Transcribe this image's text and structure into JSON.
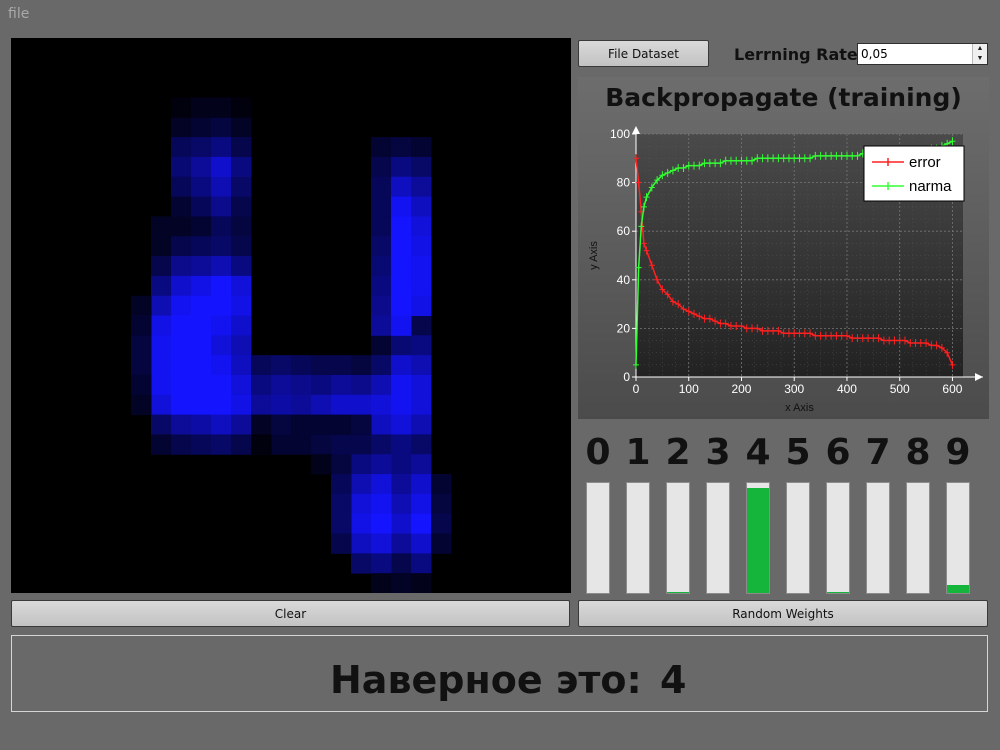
{
  "menu": {
    "file": "file"
  },
  "toolbar": {
    "file_dataset_label": "File Dataset",
    "learning_rate_label": "Lerrning Rate",
    "learning_rate_value": "0,05"
  },
  "canvas": {
    "grid_size": 28,
    "pixels": [
      [
        8,
        4,
        0.15
      ],
      [
        8,
        5,
        0.35
      ],
      [
        8,
        6,
        0.45
      ],
      [
        8,
        7,
        0.35
      ],
      [
        8,
        8,
        0.2
      ],
      [
        8,
        9,
        0.15
      ],
      [
        9,
        4,
        0.2
      ],
      [
        9,
        5,
        0.4
      ],
      [
        9,
        6,
        0.6
      ],
      [
        9,
        7,
        0.5
      ],
      [
        9,
        8,
        0.35
      ],
      [
        9,
        9,
        0.2
      ],
      [
        10,
        4,
        0.25
      ],
      [
        10,
        5,
        0.5
      ],
      [
        10,
        6,
        0.8
      ],
      [
        10,
        7,
        0.7
      ],
      [
        10,
        8,
        0.55
      ],
      [
        10,
        9,
        0.35
      ],
      [
        11,
        4,
        0.15
      ],
      [
        11,
        5,
        0.3
      ],
      [
        11,
        6,
        0.5
      ],
      [
        11,
        7,
        0.4
      ],
      [
        11,
        8,
        0.3
      ],
      [
        11,
        9,
        0.25
      ],
      [
        7,
        10,
        0.15
      ],
      [
        7,
        11,
        0.3
      ],
      [
        7,
        12,
        0.5
      ],
      [
        7,
        13,
        0.7
      ],
      [
        7,
        14,
        0.9
      ],
      [
        7,
        15,
        0.95
      ],
      [
        7,
        16,
        0.95
      ],
      [
        7,
        17,
        0.95
      ],
      [
        7,
        18,
        0.85
      ],
      [
        7,
        19,
        0.4
      ],
      [
        7,
        20,
        0.2
      ],
      [
        8,
        10,
        0.3
      ],
      [
        8,
        11,
        0.55
      ],
      [
        8,
        12,
        0.8
      ],
      [
        8,
        13,
        0.95
      ],
      [
        8,
        14,
        1
      ],
      [
        8,
        15,
        1
      ],
      [
        8,
        16,
        1
      ],
      [
        8,
        17,
        1
      ],
      [
        8,
        18,
        1
      ],
      [
        8,
        19,
        0.6
      ],
      [
        8,
        20,
        0.3
      ],
      [
        9,
        10,
        0.35
      ],
      [
        9,
        11,
        0.6
      ],
      [
        9,
        12,
        0.9
      ],
      [
        9,
        13,
        1
      ],
      [
        9,
        14,
        1
      ],
      [
        9,
        15,
        1
      ],
      [
        9,
        16,
        1
      ],
      [
        9,
        17,
        1
      ],
      [
        9,
        18,
        1
      ],
      [
        9,
        19,
        0.65
      ],
      [
        9,
        20,
        0.35
      ],
      [
        10,
        10,
        0.4
      ],
      [
        10,
        11,
        0.7
      ],
      [
        10,
        12,
        1
      ],
      [
        10,
        13,
        1
      ],
      [
        10,
        14,
        0.95
      ],
      [
        10,
        15,
        0.85
      ],
      [
        10,
        16,
        0.95
      ],
      [
        10,
        17,
        1
      ],
      [
        10,
        18,
        1
      ],
      [
        10,
        19,
        0.75
      ],
      [
        10,
        20,
        0.4
      ],
      [
        11,
        10,
        0.3
      ],
      [
        11,
        11,
        0.5
      ],
      [
        11,
        12,
        0.85
      ],
      [
        11,
        13,
        0.9
      ],
      [
        11,
        14,
        0.8
      ],
      [
        11,
        15,
        0.7
      ],
      [
        11,
        16,
        0.75
      ],
      [
        11,
        17,
        0.85
      ],
      [
        11,
        18,
        0.9
      ],
      [
        11,
        19,
        0.6
      ],
      [
        11,
        20,
        0.3
      ],
      [
        12,
        16,
        0.35
      ],
      [
        12,
        17,
        0.5
      ],
      [
        12,
        18,
        0.6
      ],
      [
        12,
        19,
        0.4
      ],
      [
        12,
        20,
        0.2
      ],
      [
        13,
        16,
        0.4
      ],
      [
        13,
        17,
        0.6
      ],
      [
        13,
        18,
        0.65
      ],
      [
        13,
        19,
        0.45
      ],
      [
        13,
        20,
        0.2
      ],
      [
        14,
        16,
        0.35
      ],
      [
        14,
        17,
        0.55
      ],
      [
        14,
        18,
        0.6
      ],
      [
        14,
        19,
        0.45
      ],
      [
        14,
        20,
        0.2
      ],
      [
        15,
        16,
        0.3
      ],
      [
        15,
        17,
        0.5
      ],
      [
        15,
        18,
        0.7
      ],
      [
        15,
        19,
        0.5
      ],
      [
        15,
        20,
        0.25
      ],
      [
        16,
        16,
        0.3
      ],
      [
        16,
        17,
        0.6
      ],
      [
        16,
        18,
        0.8
      ],
      [
        16,
        19,
        0.6
      ],
      [
        16,
        20,
        0.3
      ],
      [
        17,
        16,
        0.25
      ],
      [
        17,
        17,
        0.55
      ],
      [
        17,
        18,
        0.8
      ],
      [
        17,
        19,
        0.6
      ],
      [
        17,
        20,
        0.3
      ],
      [
        18,
        15,
        0.2
      ],
      [
        18,
        16,
        0.4
      ],
      [
        18,
        17,
        0.7
      ],
      [
        18,
        18,
        0.85
      ],
      [
        18,
        19,
        0.75
      ],
      [
        18,
        20,
        0.4
      ],
      [
        19,
        14,
        0.25
      ],
      [
        19,
        15,
        0.45
      ],
      [
        19,
        16,
        0.8
      ],
      [
        19,
        17,
        0.95
      ],
      [
        19,
        18,
        0.95
      ],
      [
        19,
        19,
        0.85
      ],
      [
        19,
        20,
        0.5
      ],
      [
        20,
        14,
        0.3
      ],
      [
        20,
        15,
        0.5
      ],
      [
        20,
        16,
        0.7
      ],
      [
        20,
        17,
        0.85
      ],
      [
        20,
        18,
        0.85
      ],
      [
        20,
        19,
        0.7
      ],
      [
        20,
        20,
        0.4
      ],
      [
        18,
        5,
        0.2
      ],
      [
        18,
        6,
        0.3
      ],
      [
        18,
        7,
        0.35
      ],
      [
        18,
        8,
        0.35
      ],
      [
        18,
        9,
        0.35
      ],
      [
        18,
        10,
        0.4
      ],
      [
        18,
        11,
        0.45
      ],
      [
        18,
        12,
        0.5
      ],
      [
        18,
        13,
        0.55
      ],
      [
        18,
        14,
        0.6
      ],
      [
        19,
        5,
        0.25
      ],
      [
        19,
        6,
        0.5
      ],
      [
        19,
        7,
        0.75
      ],
      [
        19,
        8,
        0.95
      ],
      [
        19,
        9,
        1
      ],
      [
        19,
        10,
        1
      ],
      [
        19,
        11,
        1
      ],
      [
        19,
        12,
        1
      ],
      [
        19,
        13,
        1
      ],
      [
        19,
        14,
        0.95
      ],
      [
        19,
        21,
        0.5
      ],
      [
        19,
        22,
        0.6
      ],
      [
        19,
        23,
        0.7
      ],
      [
        19,
        24,
        0.8
      ],
      [
        19,
        25,
        0.6
      ],
      [
        19,
        26,
        0.3
      ],
      [
        20,
        5,
        0.2
      ],
      [
        20,
        6,
        0.4
      ],
      [
        20,
        7,
        0.6
      ],
      [
        20,
        8,
        0.75
      ],
      [
        20,
        9,
        0.85
      ],
      [
        20,
        10,
        0.9
      ],
      [
        20,
        11,
        0.95
      ],
      [
        20,
        12,
        0.95
      ],
      [
        20,
        13,
        0.9
      ],
      [
        20,
        21,
        0.6
      ],
      [
        20,
        22,
        0.8
      ],
      [
        20,
        23,
        0.9
      ],
      [
        20,
        24,
        1
      ],
      [
        20,
        25,
        0.8
      ],
      [
        20,
        26,
        0.5
      ],
      [
        17,
        21,
        0.5
      ],
      [
        17,
        22,
        0.7
      ],
      [
        17,
        23,
        0.85
      ],
      [
        17,
        24,
        0.9
      ],
      [
        17,
        25,
        0.75
      ],
      [
        17,
        26,
        0.4
      ],
      [
        18,
        21,
        0.6
      ],
      [
        18,
        22,
        0.85
      ],
      [
        18,
        23,
        0.95
      ],
      [
        18,
        24,
        1
      ],
      [
        18,
        25,
        0.85
      ],
      [
        18,
        26,
        0.5
      ],
      [
        21,
        22,
        0.2
      ],
      [
        21,
        23,
        0.25
      ],
      [
        21,
        24,
        0.3
      ],
      [
        21,
        25,
        0.2
      ],
      [
        16,
        21,
        0.25
      ],
      [
        16,
        22,
        0.35
      ],
      [
        16,
        23,
        0.4
      ],
      [
        16,
        24,
        0.4
      ],
      [
        16,
        25,
        0.3
      ],
      [
        6,
        13,
        0.15
      ],
      [
        6,
        14,
        0.2
      ],
      [
        6,
        15,
        0.25
      ],
      [
        6,
        16,
        0.25
      ],
      [
        6,
        17,
        0.2
      ],
      [
        6,
        18,
        0.15
      ],
      [
        7,
        9,
        0.15
      ],
      [
        8,
        3,
        0.05
      ],
      [
        9,
        3,
        0.1
      ],
      [
        10,
        3,
        0.1
      ],
      [
        11,
        3,
        0.05
      ],
      [
        12,
        19,
        0.15
      ],
      [
        13,
        19,
        0.25
      ],
      [
        14,
        19,
        0.2
      ],
      [
        15,
        19,
        0.2
      ],
      [
        16,
        19,
        0.2
      ],
      [
        17,
        19,
        0.25
      ],
      [
        12,
        20,
        0.05
      ],
      [
        15,
        21,
        0.1
      ],
      [
        18,
        27,
        0.1
      ],
      [
        19,
        27,
        0.15
      ],
      [
        20,
        27,
        0.1
      ]
    ]
  },
  "clear_label": "Clear",
  "random_weights_label": "Random Weights",
  "chart_data": {
    "type": "line",
    "title": "Backpropagate (training)",
    "xlabel": "x Axis",
    "ylabel": "y Axis",
    "xlim": [
      0,
      620
    ],
    "ylim": [
      0,
      100
    ],
    "xticks": [
      "0",
      "100",
      "200",
      "300",
      "400",
      "500",
      "600"
    ],
    "yticks": [
      "0",
      "20",
      "40",
      "60",
      "80",
      "100"
    ],
    "grid": true,
    "legend_position": "top-right",
    "series": [
      {
        "name": "error",
        "color": "#ff2020",
        "x": [
          0,
          5,
          10,
          15,
          20,
          30,
          40,
          50,
          60,
          70,
          80,
          90,
          100,
          110,
          120,
          130,
          140,
          150,
          160,
          170,
          180,
          190,
          200,
          210,
          220,
          230,
          240,
          250,
          260,
          270,
          280,
          290,
          300,
          310,
          320,
          330,
          340,
          350,
          360,
          370,
          380,
          390,
          400,
          410,
          420,
          430,
          440,
          450,
          460,
          470,
          480,
          490,
          500,
          510,
          520,
          530,
          540,
          550,
          560,
          570,
          580,
          590,
          600
        ],
        "y": [
          90,
          80,
          68,
          55,
          52,
          46,
          40,
          36,
          34,
          31,
          30,
          28,
          27,
          26,
          25,
          24,
          24,
          23,
          22,
          22,
          21,
          21,
          21,
          20,
          20,
          20,
          19,
          19,
          19,
          19,
          18,
          18,
          18,
          18,
          18,
          18,
          17,
          17,
          17,
          17,
          17,
          17,
          17,
          16,
          16,
          16,
          16,
          16,
          16,
          15,
          15,
          15,
          15,
          15,
          14,
          14,
          14,
          14,
          13,
          13,
          12,
          10,
          5
        ]
      },
      {
        "name": "narma",
        "color": "#33ff33",
        "x": [
          0,
          5,
          10,
          15,
          20,
          30,
          40,
          50,
          60,
          70,
          80,
          90,
          100,
          110,
          120,
          130,
          140,
          150,
          160,
          170,
          180,
          190,
          200,
          210,
          220,
          230,
          240,
          250,
          260,
          270,
          280,
          290,
          300,
          310,
          320,
          330,
          340,
          350,
          360,
          370,
          380,
          390,
          400,
          410,
          420,
          430,
          440,
          450,
          460,
          470,
          480,
          490,
          500,
          510,
          520,
          530,
          540,
          550,
          560,
          570,
          580,
          590,
          600
        ],
        "y": [
          5,
          45,
          62,
          70,
          74,
          78,
          81,
          83,
          84,
          85,
          86,
          86,
          87,
          87,
          87,
          88,
          88,
          88,
          88,
          89,
          89,
          89,
          89,
          89,
          89,
          90,
          90,
          90,
          90,
          90,
          90,
          90,
          90,
          90,
          90,
          90,
          91,
          91,
          91,
          91,
          91,
          91,
          91,
          91,
          91,
          92,
          92,
          92,
          92,
          92,
          92,
          92,
          92,
          93,
          93,
          93,
          93,
          93,
          94,
          94,
          95,
          96,
          97
        ]
      }
    ]
  },
  "digits": [
    {
      "label": "0",
      "value": 0.0
    },
    {
      "label": "1",
      "value": 0.0
    },
    {
      "label": "2",
      "value": 0.01
    },
    {
      "label": "3",
      "value": 0.0
    },
    {
      "label": "4",
      "value": 0.95
    },
    {
      "label": "5",
      "value": 0.0
    },
    {
      "label": "6",
      "value": 0.01
    },
    {
      "label": "7",
      "value": 0.0
    },
    {
      "label": "8",
      "value": 0.0
    },
    {
      "label": "9",
      "value": 0.07
    }
  ],
  "result": {
    "label": "Наверное это:",
    "value": "4"
  },
  "colors": {
    "fill": "#15b43a",
    "canvas_bg": "#000000",
    "digit_pixel": "#1010ff"
  }
}
